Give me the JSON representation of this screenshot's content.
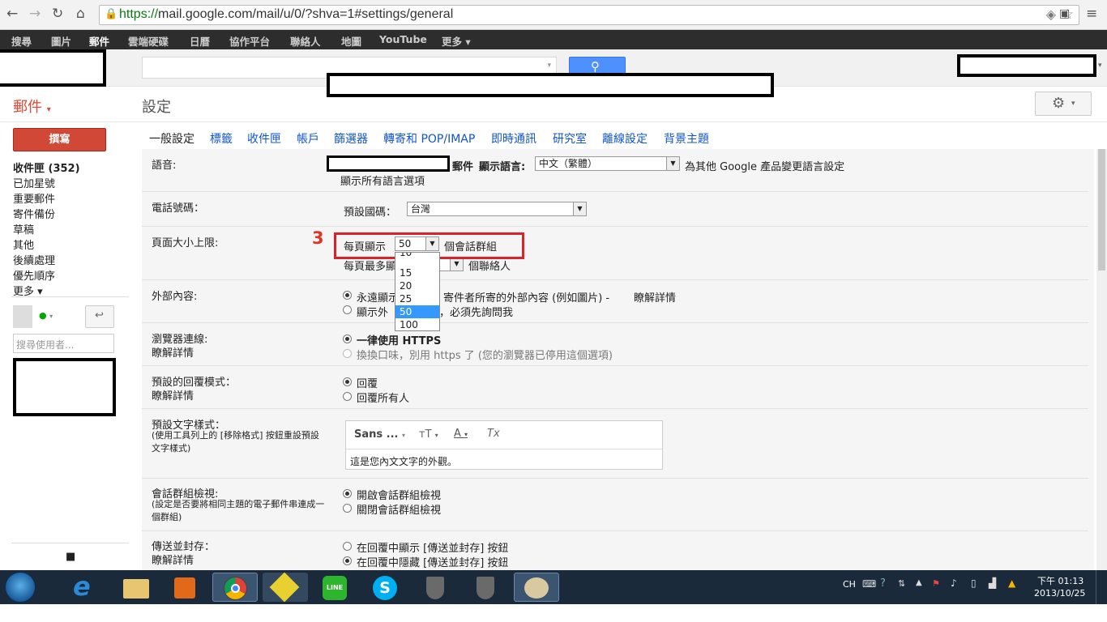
{
  "browser": {
    "url_scheme": "https://",
    "url_host": "mail.google.com",
    "url_path": "/mail/u/0/?shva=1#settings/general"
  },
  "gbar": {
    "items": [
      "搜尋",
      "圖片",
      "郵件",
      "雲端硬碟",
      "日曆",
      "協作平台",
      "聯絡人",
      "地圖",
      "YouTube",
      "更多"
    ]
  },
  "app": {
    "label": "郵件",
    "settings_title": "設定"
  },
  "nav": {
    "compose": "撰寫",
    "items": [
      "收件匣 (352)",
      "已加星號",
      "重要郵件",
      "寄件備份",
      "草稿",
      "其他",
      "後續處理",
      "優先順序",
      "更多"
    ],
    "search_placeholder": "搜尋使用者..."
  },
  "tabs": [
    "一般設定",
    "標籤",
    "收件匣",
    "帳戶",
    "篩選器",
    "轉寄和 POP/IMAP",
    "即時通訊",
    "研究室",
    "離線設定",
    "背景主題"
  ],
  "settings": {
    "language": {
      "label": "語音:",
      "mail": "郵件",
      "display_lang": "顯示語言:",
      "value": "中文（繁體）",
      "other_link": "為其他 Google 產品變更語言設定",
      "all_link": "顯示所有語言選項"
    },
    "phone": {
      "label": "電話號碼：",
      "default_country": "預設國碼：",
      "value": "台灣"
    },
    "page_size": {
      "label": "頁面大小上限:",
      "show_per_page": "每頁顯示",
      "value": "50",
      "unit": "個會話群組",
      "contacts_prefix": "每頁最多顯",
      "contacts_unit": "個聯絡人",
      "step_marker": "3",
      "dropdown_options": [
        "10",
        "15",
        "20",
        "25",
        "50",
        "100"
      ],
      "selected": "50"
    },
    "external": {
      "label": "外部內容:",
      "opt1": "永遠顯示",
      "opt1_tail": "寄件者所寄的外部內容 (例如圖片) -",
      "opt1_link": "瞭解詳情",
      "opt2": "顯示外",
      "opt2_tail": "，必須先詢問我"
    },
    "browser_conn": {
      "label": "瀏覽器連線:",
      "learn": "瞭解詳情",
      "opt1": "一律使用 HTTPS",
      "opt2": "換換口味，別用 https 了 (您的瀏覽器已停用這個選項)"
    },
    "reply": {
      "label": "預設的回覆模式：",
      "learn": "瞭解詳情",
      "opt1": "回覆",
      "opt2": "回覆所有人"
    },
    "text_style": {
      "label": "預設文字樣式：",
      "sub": "(使用工具列上的 [移除格式] 按鈕重設預設文字樣式)",
      "font": "Sans ...",
      "preview": "這是您內文文字的外觀。"
    },
    "conversation": {
      "label": "會話群組檢視:",
      "sub": "(設定是否要將相同主題的電子郵件串連成一個群組)",
      "opt1": "開啟會話群組檢視",
      "opt2": "關閉會話群組檢視"
    },
    "send_archive": {
      "label": "傳送並封存：",
      "learn": "瞭解詳情",
      "opt1": "在回覆中顯示 [傳送並封存] 按鈕",
      "opt2": "在回覆中隱藏 [傳送並封存] 按鈕"
    }
  },
  "taskbar": {
    "lang": "CH",
    "time": "下午 01:13",
    "date": "2013/10/25"
  }
}
